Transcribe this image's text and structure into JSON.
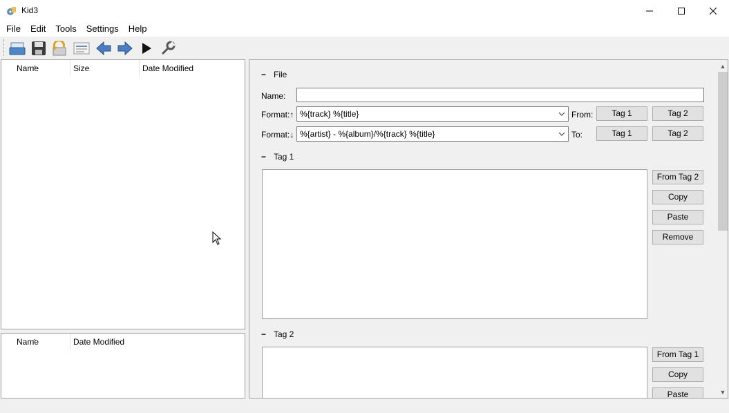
{
  "window": {
    "title": "Kid3",
    "controls": {
      "minimize": "minimize-icon",
      "maximize": "maximize-icon",
      "close": "close-icon"
    }
  },
  "menu": [
    "File",
    "Edit",
    "Tools",
    "Settings",
    "Help"
  ],
  "toolbar": {
    "buttons": [
      "open-icon",
      "save-icon",
      "revert-icon",
      "playlist-icon",
      "previous-icon",
      "next-icon",
      "play-icon",
      "settings-icon"
    ]
  },
  "file_list": {
    "columns": [
      "Name",
      "Size",
      "Date Modified"
    ]
  },
  "dir_list": {
    "columns": [
      "Name",
      "Date Modified"
    ]
  },
  "file_section": {
    "title": "File",
    "name_label": "Name:",
    "name_value": "",
    "format_from_label": "Format:↑",
    "format_from_value": "%{track} %{title}",
    "from_label": "From:",
    "from_tag1": "Tag 1",
    "from_tag2": "Tag 2",
    "format_to_label": "Format:↓",
    "format_to_value": "%{artist} - %{album}/%{track} %{title}",
    "to_label": "To:",
    "to_tag1": "Tag 1",
    "to_tag2": "Tag 2"
  },
  "tag1": {
    "title": "Tag 1",
    "from_button": "From Tag 2",
    "copy": "Copy",
    "paste": "Paste",
    "remove": "Remove"
  },
  "tag2": {
    "title": "Tag 2",
    "from_button": "From Tag 1",
    "copy": "Copy",
    "paste": "Paste"
  },
  "toggle_symbol": "−"
}
